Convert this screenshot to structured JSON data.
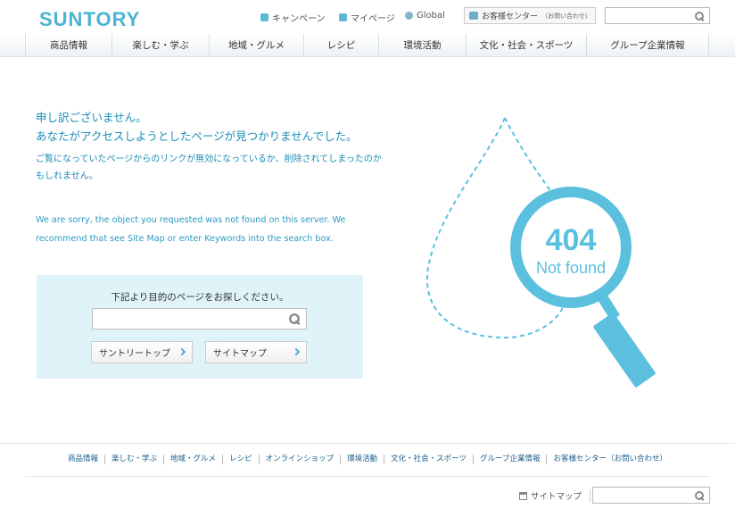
{
  "header": {
    "logo": "SUNTORY",
    "campaign": "キャンペーン",
    "mypage": "マイページ",
    "global": "Global",
    "contact_main": "お客様センター",
    "contact_sub": "（お問い合わせ）",
    "search_placeholder": ""
  },
  "nav": [
    {
      "label": "商品情報"
    },
    {
      "label": "楽しむ・学ぶ"
    },
    {
      "label": "地域・グルメ"
    },
    {
      "label": "レシピ"
    },
    {
      "label": "環境活動"
    },
    {
      "label": "文化・社会・スポーツ"
    },
    {
      "label": "グループ企業情報"
    }
  ],
  "main": {
    "heading_line1": "申し訳ございません。",
    "heading_line2": "あなたがアクセスしようとしたページが見つかりませんでした。",
    "jp_desc": "ご覧になっていたページからのリンクが無効になっているか、削除されてしまったのかもしれません。",
    "en_desc": "We are sorry, the object you requested was not found on this server. We recommend that see Site Map or enter Keywords into the search box.",
    "search_label": "下記より目的のページをお探しください。",
    "search_placeholder": "",
    "btn_top": "サントリートップ",
    "btn_sitemap": "サイトマップ"
  },
  "art": {
    "code": "404",
    "text": "Not found",
    "color": "#5bc0de"
  },
  "footer": {
    "links": [
      "商品情報",
      "楽しむ・学ぶ",
      "地域・グルメ",
      "レシピ",
      "オンラインショップ",
      "環境活動",
      "文化・社会・スポーツ",
      "グループ企業情報",
      "お客様センター（お問い合わせ）"
    ],
    "sitemap": "サイトマップ",
    "search_placeholder": ""
  }
}
